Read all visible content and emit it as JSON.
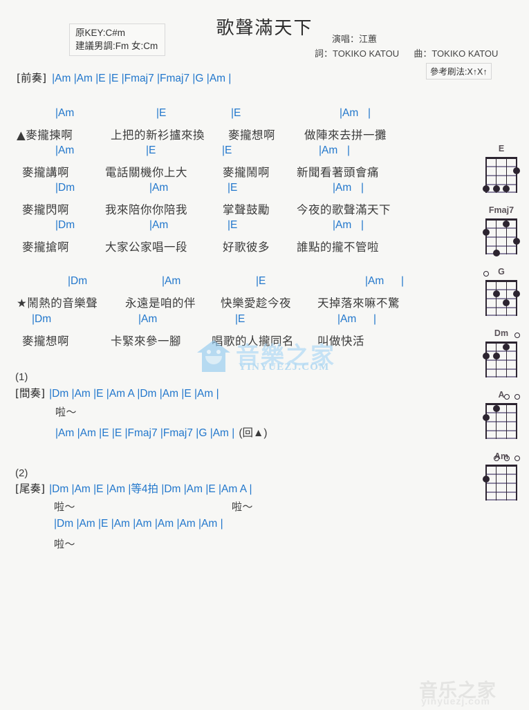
{
  "header": {
    "title": "歌聲滿天下",
    "key_line1": "原KEY:C#m",
    "key_line2": "建議男調:Fm 女:Cm",
    "singer_label": "演唱：江蕙",
    "lyricist": "詞：TOKIKO KATOU",
    "composer": "曲：TOKIKO KATOU",
    "strum_pattern": "參考刷法:X↑X↑"
  },
  "colors": {
    "chord": "#2277cc",
    "lyric": "#3b3b3b",
    "paper": "#f7f7f5",
    "diagram_name": "#5a5258",
    "watermark_blue": "#a8d6f5"
  },
  "sections": {
    "intro": {
      "label": "[前奏]",
      "chords": "|Am   |Am   |E   |E   |Fmaj7   |Fmaj7   |G   |Am   |"
    },
    "verse1": [
      {
        "chords": "|Am",
        "chords_full": "|Am          |E          |E          |Am   |",
        "lyrics": "▲麥攏揀啊  上把的新衫攎來換  麥攏想啊  做陣來去拼一攤"
      },
      {
        "chords_full": "|Am          |E          |E          |Am   |",
        "lyrics": "麥攏講啊  電話關機你上大  麥攏鬧啊  新聞看著頭會痛"
      },
      {
        "chords_full": "|Dm          |Am          |E          |Am   |",
        "lyrics": "麥攏閃啊  我來陪你你陪我  掌聲鼓勵  今夜的歌聲滿天下"
      },
      {
        "chords_full": "|Dm          |Am          |E          |Am   |",
        "lyrics": "麥攏搶啊  大家公家唱一段  好歌彼多  誰點的攏不管啦"
      }
    ],
    "chorus": [
      {
        "chords_full": "|Dm          |Am          |E          |Am   |",
        "lyrics": "★鬧熱的音樂聲  永遠是咱的伴  快樂愛趁今夜  天掉落來嘛不驚"
      },
      {
        "chords_full": "|Dm          |Am          |E          |Am   |",
        "lyrics": "麥攏想啊  卡緊來參一腳  唱歌的人攏同名  叫做快活"
      }
    ],
    "ending1": {
      "number": "(1)",
      "label": "[間奏]",
      "chords": "|Dm   |Am   |E   |Am   A   |Dm   |Am   |E   |Am   |",
      "lyrics": "啦～",
      "chords2": "|Am   |Am   |E   |E   |Fmaj7   |Fmaj7   |G   |Am   |",
      "repeat": "(回▲)"
    },
    "ending2": {
      "number": "(2)",
      "label": "[尾奏]",
      "chords": "|Dm   |Am   |E   |Am   |等4拍 |Dm   |Am   |E   |Am   A   |",
      "lyrics_a": "啦～",
      "lyrics_b": "啦～",
      "chords2": "|Dm   |Am   |E   |Am   |Am   |Am   |Am   |Am   |",
      "lyrics_c": "啦～"
    }
  },
  "chord_lines": {
    "intro_label": "[前奏]",
    "intro_chords": [
      "|Am",
      "|Am",
      "|E",
      "|E",
      "|Fmaj7",
      "|Fmaj7",
      "|G",
      "|Am",
      "|"
    ],
    "v1_chords": [
      "|Am",
      "|E",
      "|E",
      "|Am",
      "|"
    ],
    "v2_chords": [
      "|Am",
      "|E",
      "|E",
      "|Am",
      "|"
    ],
    "v3_chords": [
      "|Dm",
      "|Am",
      "|E",
      "|Am",
      "|"
    ],
    "v4_chords": [
      "|Dm",
      "|Am",
      "|E",
      "|Am",
      "|"
    ],
    "c1_chords": [
      "|Dm",
      "|Am",
      "|E",
      "|Am",
      "|"
    ],
    "c2_chords": [
      "|Dm",
      "|Am",
      "|E",
      "|Am",
      "|"
    ]
  },
  "lyrics": {
    "v1": [
      "▲麥攏揀啊",
      "上把的新衫攎來換",
      "麥攏想啊",
      "做陣來去拼一攤"
    ],
    "v2": [
      "麥攏講啊",
      "電話關機你上大",
      "麥攏鬧啊",
      "新聞看著頭會痛"
    ],
    "v3": [
      "麥攏閃啊",
      "我來陪你你陪我",
      "掌聲鼓勵",
      "今夜的歌聲滿天下"
    ],
    "v4": [
      "麥攏搶啊",
      "大家公家唱一段",
      "好歌彼多",
      "誰點的攏不管啦"
    ],
    "c1": [
      "★鬧熱的音樂聲",
      "永遠是咱的伴",
      "快樂愛趁今夜",
      "天掉落來嘛不驚"
    ],
    "c2": [
      "麥攏想啊",
      "卡緊來參一腳",
      "唱歌的人攏同名",
      "叫做快活"
    ]
  },
  "diagrams": [
    {
      "name": "E",
      "dots": [
        [
          4,
          2
        ],
        [
          1,
          4
        ],
        [
          2,
          4
        ],
        [
          3,
          4
        ]
      ],
      "open": []
    },
    {
      "name": "Fmaj7",
      "dots": [
        [
          2,
          1
        ],
        [
          4,
          2
        ],
        [
          1,
          3
        ],
        [
          3,
          5
        ]
      ],
      "open": []
    },
    {
      "name": "G",
      "dots": [
        [
          3,
          2
        ],
        [
          1,
          2
        ],
        [
          2,
          3
        ]
      ],
      "open": [
        4
      ]
    },
    {
      "name": "Dm",
      "dots": [
        [
          2,
          1
        ],
        [
          4,
          2
        ],
        [
          3,
          2
        ]
      ],
      "open": [
        1
      ]
    },
    {
      "name": "A",
      "dots": [
        [
          3,
          1
        ],
        [
          4,
          2
        ]
      ],
      "open": [
        1,
        2
      ]
    },
    {
      "name": "Am",
      "dots": [
        [
          4,
          2
        ]
      ],
      "open": [
        1,
        2,
        3
      ]
    }
  ],
  "watermark": {
    "center_text": "音樂之家",
    "center_url": "YINYUEZJ.COM",
    "bottom_text": "音乐之家",
    "bottom_url": "yinyuezj.com"
  }
}
